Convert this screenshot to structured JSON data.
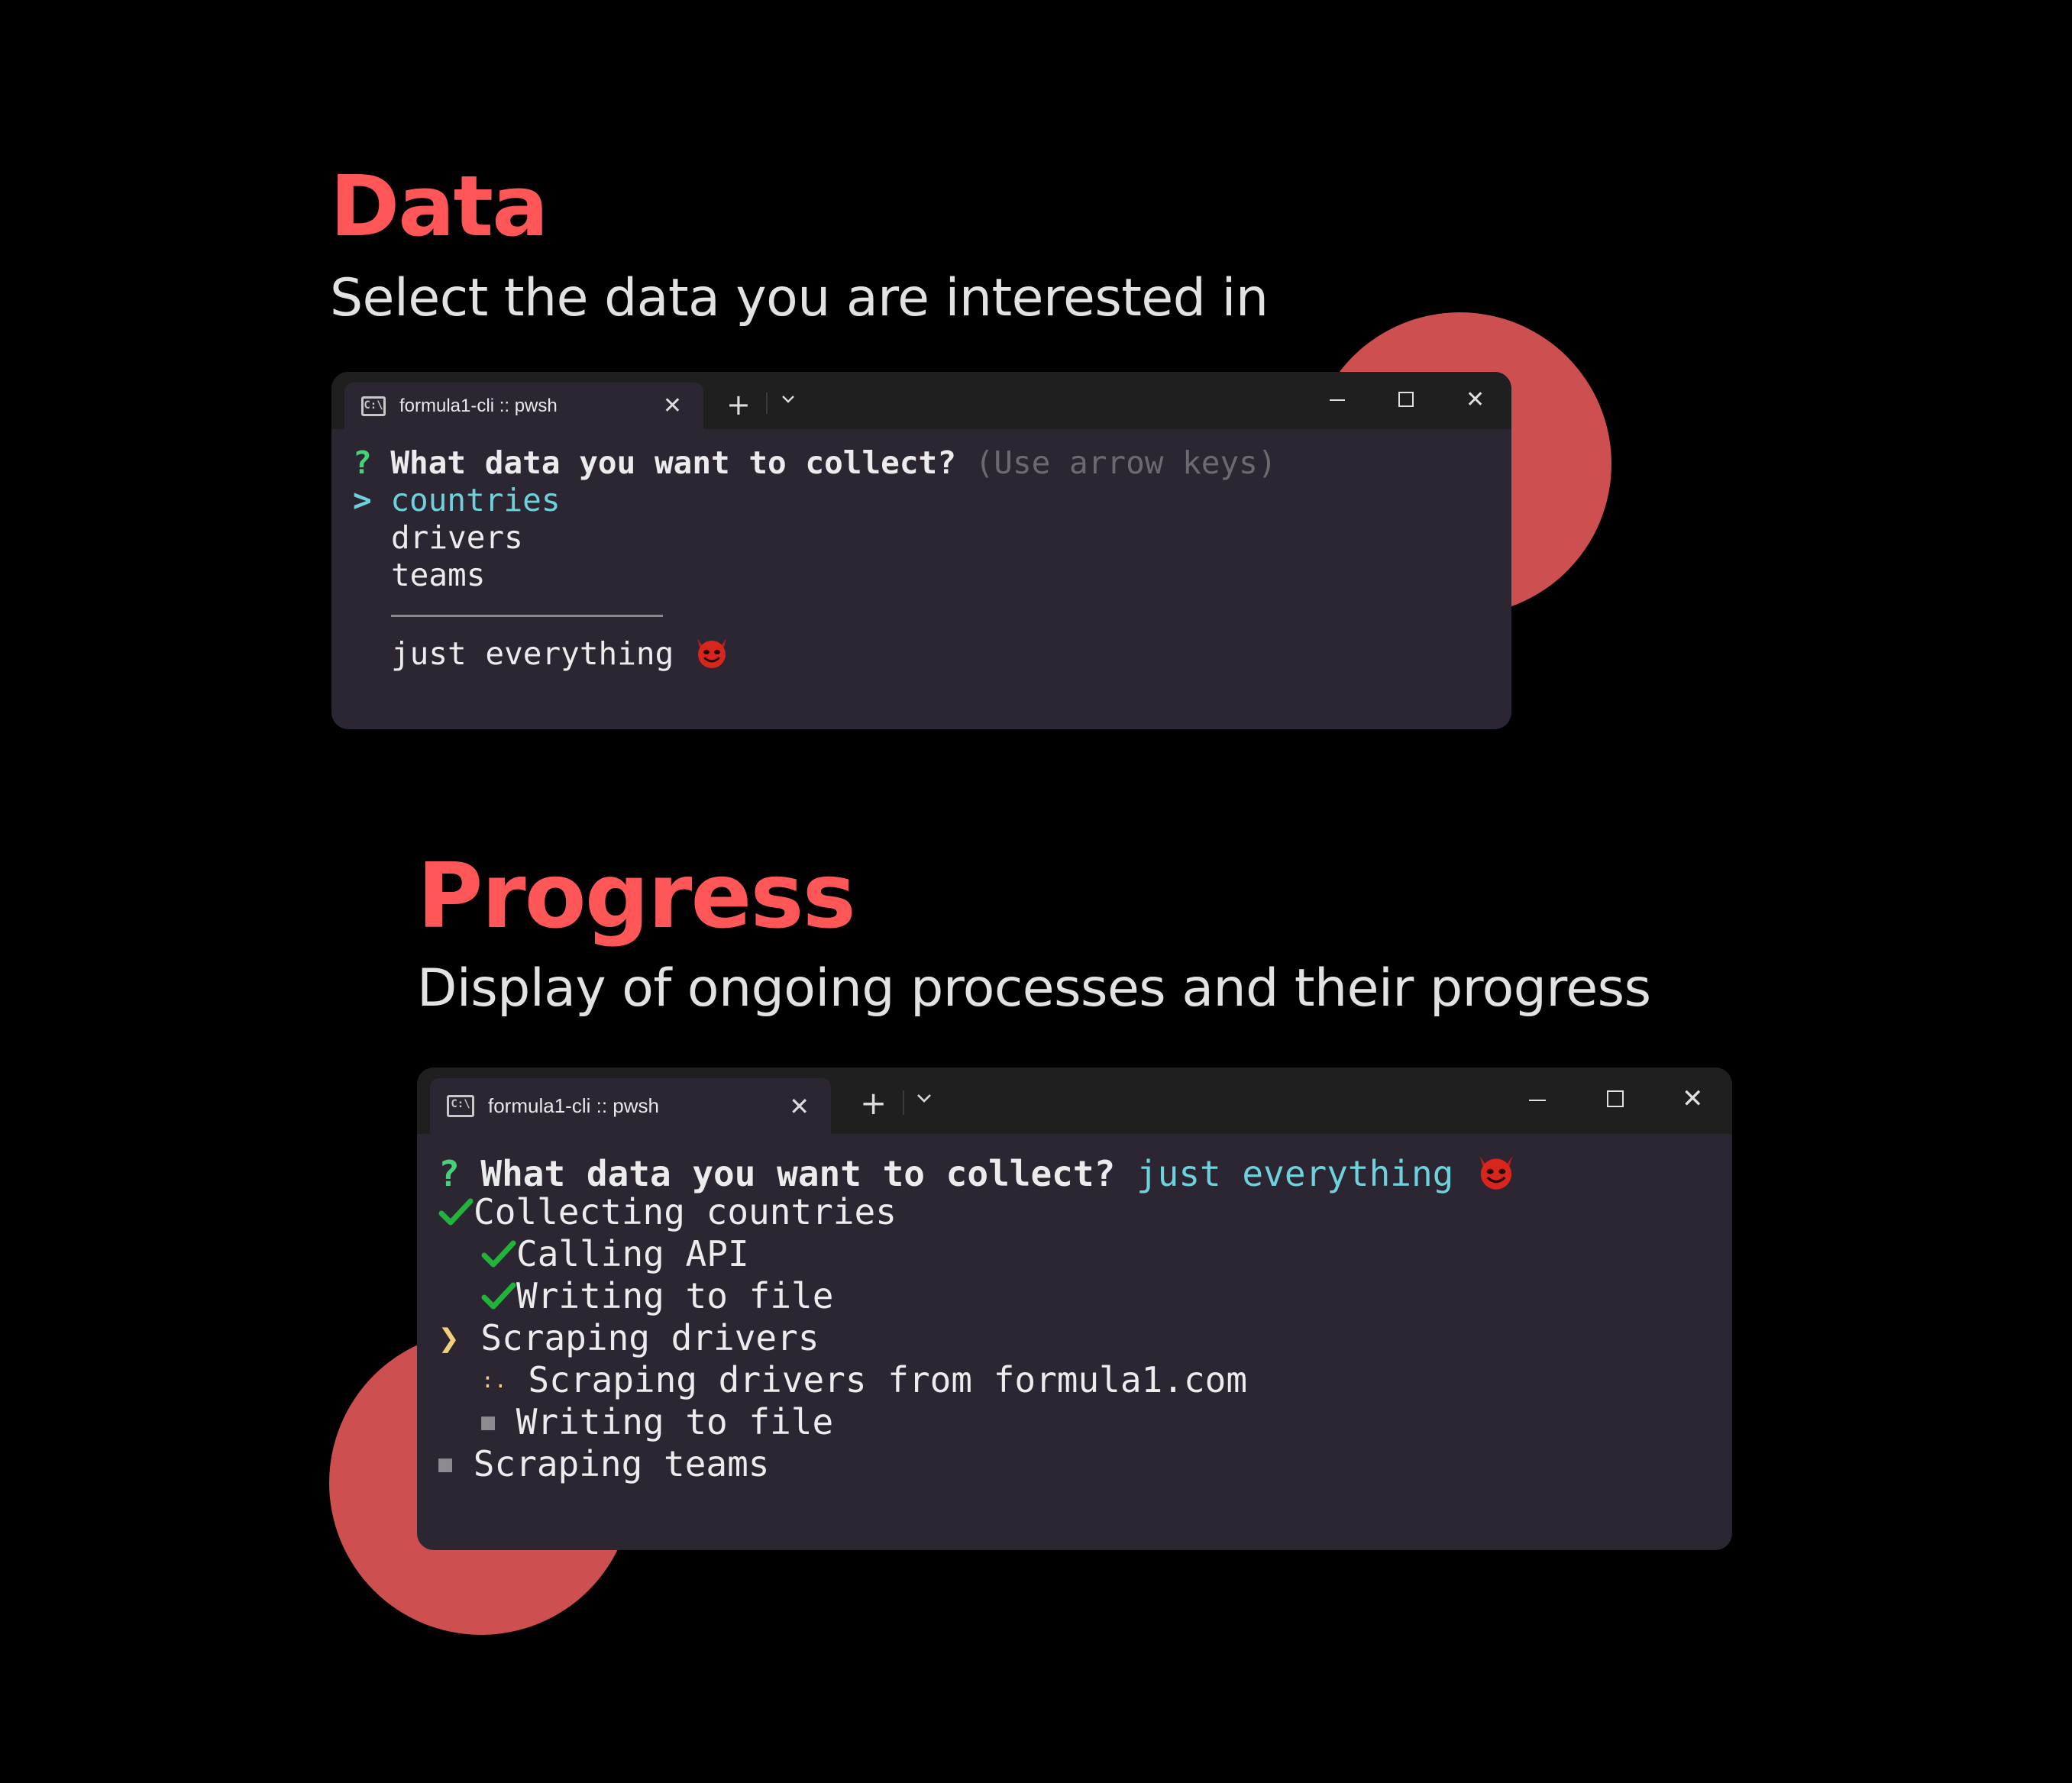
{
  "section_data": {
    "title": "Data",
    "subtitle": "Select the data you are interested in",
    "terminal": {
      "tab_title": "formula1-cli :: pwsh",
      "tab_icon": "terminal-icon",
      "question_mark": "?",
      "question": "What data you want to collect?",
      "hint": "(Use arrow keys)",
      "cursor": ">",
      "options": [
        "countries",
        "drivers",
        "teams"
      ],
      "extra_option": "just everything",
      "extra_option_icon": "smiling-devil-emoji-icon"
    }
  },
  "section_progress": {
    "title": "Progress",
    "subtitle": "Display of ongoing processes and their progress",
    "terminal": {
      "tab_title": "formula1-cli :: pwsh",
      "tab_icon": "terminal-icon",
      "question_mark": "?",
      "question": "What data you want to collect?",
      "answer": "just everything",
      "answer_icon": "smiling-devil-emoji-icon",
      "tasks": [
        {
          "status": "done",
          "label": "Collecting countries"
        },
        {
          "status": "done",
          "label": "Calling API"
        },
        {
          "status": "done",
          "label": "Writing to file"
        },
        {
          "status": "active",
          "symbol": "❯",
          "label": "Scraping drivers"
        },
        {
          "status": "running",
          "symbol": ":.",
          "label": "Scraping drivers from formula1.com"
        },
        {
          "status": "pending",
          "symbol": "■",
          "label": "Writing to file"
        },
        {
          "status": "pending",
          "symbol": "■",
          "label": "Scraping teams"
        }
      ]
    }
  },
  "colors": {
    "background": "#000000",
    "accent": "#ff5757",
    "circle": "#cd4f4f",
    "terminal_bg": "#2c2632",
    "titlebar_bg": "#1f1f1f",
    "prompt_green": "#46d27a",
    "selection_cyan": "#6fd1dc",
    "check_green": "#22b33a"
  }
}
